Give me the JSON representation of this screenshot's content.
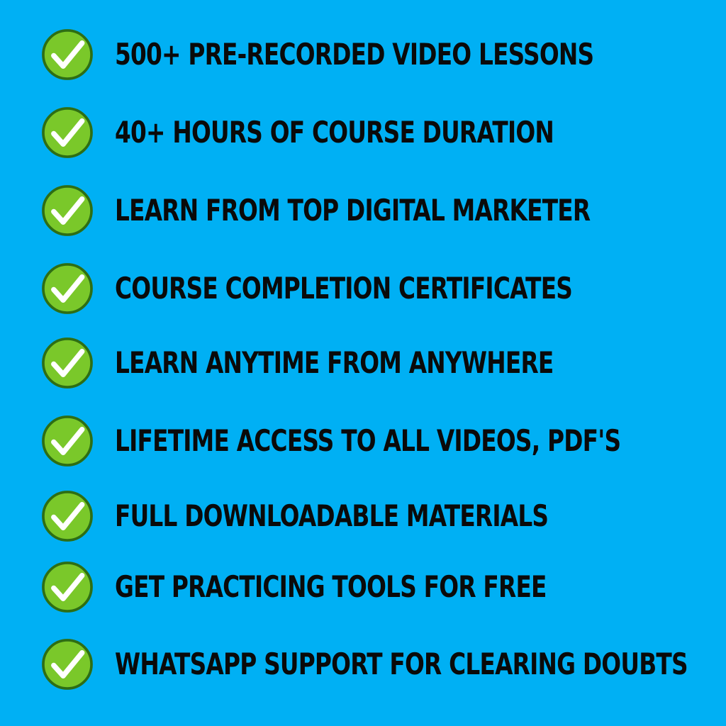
{
  "background_color": "#00b0f4",
  "check_icon": {
    "name": "checkmark-circle-icon",
    "fill_color": "#7ac82a",
    "border_color": "#2e6e14",
    "mark_color": "#ffffff"
  },
  "features": [
    "500+ PRE-RECORDED VIDEO LESSONS",
    "40+ HOURS OF COURSE DURATION",
    "LEARN FROM TOP DIGITAL MARKETER",
    "COURSE COMPLETION CERTIFICATES",
    "LEARN ANYTIME FROM ANYWHERE",
    "LIFETIME ACCESS TO ALL VIDEOS, PDF'S",
    "FULL DOWNLOADABLE MATERIALS",
    "GET PRACTICING TOOLS FOR FREE",
    "WHATSAPP SUPPORT FOR CLEARING DOUBTS"
  ]
}
